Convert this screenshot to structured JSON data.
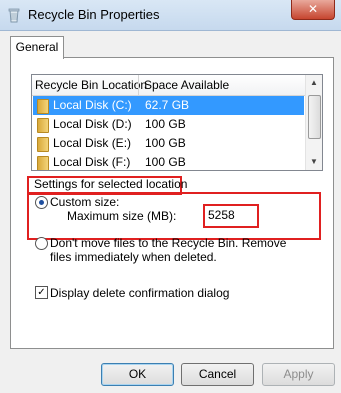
{
  "window": {
    "title": "Recycle Bin Properties",
    "close_symbol": "✕"
  },
  "tabs": [
    {
      "label": "General",
      "active": true
    }
  ],
  "list": {
    "headers": [
      "Recycle Bin Location",
      "Space Available"
    ],
    "rows": [
      {
        "location": "Local Disk (C:)",
        "space": "62.7 GB",
        "selected": true
      },
      {
        "location": "Local Disk (D:)",
        "space": "100 GB",
        "selected": false
      },
      {
        "location": "Local Disk (E:)",
        "space": "100 GB",
        "selected": false
      },
      {
        "location": "Local Disk (F:)",
        "space": "100 GB",
        "selected": false
      }
    ]
  },
  "settings": {
    "section_label": "Settings for selected location",
    "custom_size_label": "Custom size:",
    "max_size_label": "Maximum size (MB):",
    "max_size_value": "5258",
    "dont_move_label": "Don't move files to the Recycle Bin. Remove files immediately when deleted.",
    "custom_size_selected": true
  },
  "confirm": {
    "label": "Display delete confirmation dialog",
    "checked": true
  },
  "buttons": {
    "ok": "OK",
    "cancel": "Cancel",
    "apply": "Apply"
  },
  "colors": {
    "highlight": "#e02020",
    "selection": "#3399ff"
  }
}
